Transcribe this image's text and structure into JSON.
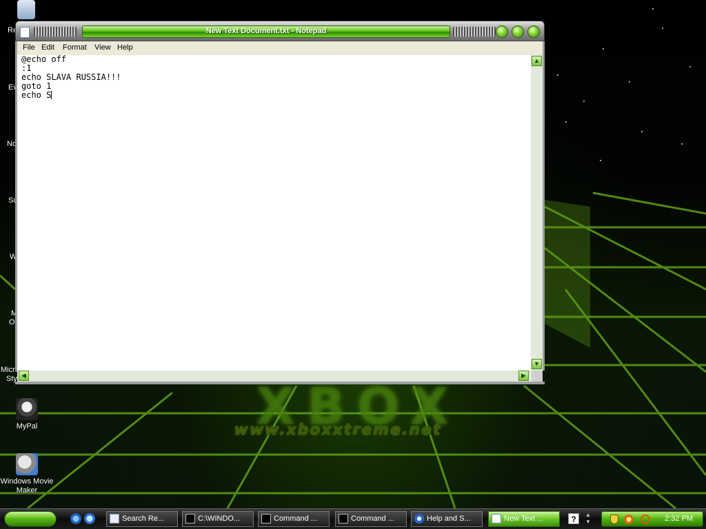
{
  "desktop": {
    "wallpaper_text": "www.xboxxtreme.net",
    "wallpaper_logo": "XBOX",
    "partial_labels": [
      "Re",
      "Ev",
      "No",
      "Su",
      "W",
      "M",
      "O",
      "Micro",
      "Sty"
    ],
    "icons": [
      {
        "label": "MyPal"
      },
      {
        "label_line1": "Windows Movie",
        "label_line2": "Maker"
      }
    ]
  },
  "notepad": {
    "title": "New Text Document.txt - Notepad",
    "menu": [
      "File",
      "Edit",
      "Format",
      "View",
      "Help"
    ],
    "text": "@echo off\n:1\necho SLAVA RUSSIA!!!\ngoto 1\necho S"
  },
  "taskbar": {
    "tasks": [
      {
        "label": "Search Re..."
      },
      {
        "label": "C:\\WINDO..."
      },
      {
        "label": "Command ..."
      },
      {
        "label": "Command ..."
      },
      {
        "label": "Help and S..."
      },
      {
        "label": "New Text ..."
      }
    ],
    "clock": "2:32 PM"
  },
  "colors": {
    "accent_green": "#62c21a",
    "window_frame": "#9e9e9e",
    "desktop_bg": "#000000"
  }
}
